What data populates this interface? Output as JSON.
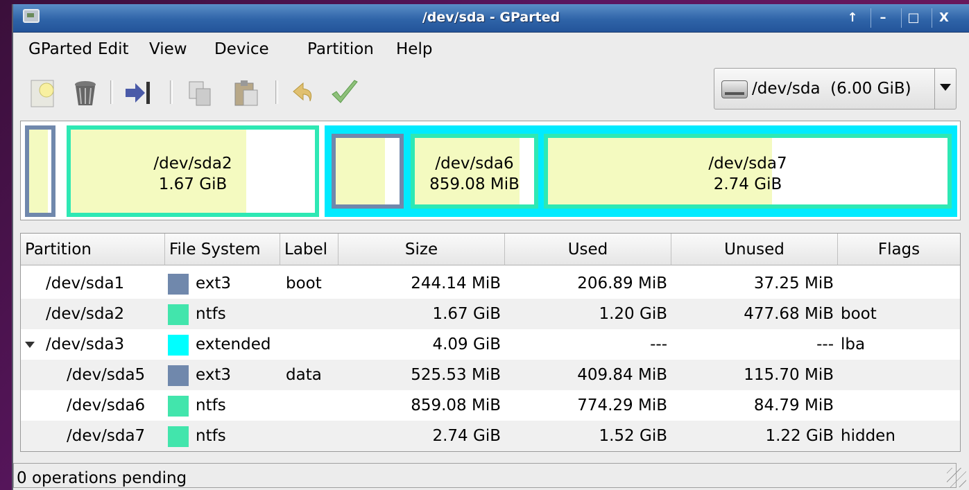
{
  "window": {
    "title": "/dev/sda - GParted"
  },
  "titlebar_buttons": {
    "up": "↑",
    "minimize": "–",
    "maximize": "□",
    "close": "X"
  },
  "menu": [
    "GParted",
    "Edit",
    "View",
    "Device",
    "Partition",
    "Help"
  ],
  "toolbar": {
    "tools": [
      "new-icon",
      "delete-icon",
      "resize-move-icon",
      "copy-icon",
      "paste-icon",
      "undo-icon",
      "apply-icon"
    ]
  },
  "device": {
    "name": "/dev/sda",
    "size": "(6.00 GiB)"
  },
  "partition_map": [
    {
      "name": "",
      "size": ""
    },
    {
      "name": "/dev/sda2",
      "size": "1.67 GiB"
    },
    {
      "name": "",
      "size": ""
    },
    {
      "name": "/dev/sda6",
      "size": "859.08 MiB"
    },
    {
      "name": "/dev/sda7",
      "size": "2.74 GiB"
    }
  ],
  "table": {
    "headers": [
      "Partition",
      "File System",
      "Label",
      "Size",
      "Used",
      "Unused",
      "Flags"
    ],
    "rows": [
      {
        "partition": "/dev/sda1",
        "fs": "ext3",
        "label": "boot",
        "size": "244.14 MiB",
        "used": "206.89 MiB",
        "unused": "37.25 MiB",
        "flags": ""
      },
      {
        "partition": "/dev/sda2",
        "fs": "ntfs",
        "label": "",
        "size": "1.67 GiB",
        "used": "1.20 GiB",
        "unused": "477.68 MiB",
        "flags": "boot"
      },
      {
        "partition": "/dev/sda3",
        "fs": "extended",
        "label": "",
        "size": "4.09 GiB",
        "used": "---",
        "unused": "---",
        "flags": "lba"
      },
      {
        "partition": "/dev/sda5",
        "fs": "ext3",
        "label": "data",
        "size": "525.53 MiB",
        "used": "409.84 MiB",
        "unused": "115.70 MiB",
        "flags": ""
      },
      {
        "partition": "/dev/sda6",
        "fs": "ntfs",
        "label": "",
        "size": "859.08 MiB",
        "used": "774.29 MiB",
        "unused": "84.79 MiB",
        "flags": ""
      },
      {
        "partition": "/dev/sda7",
        "fs": "ntfs",
        "label": "",
        "size": "2.74 GiB",
        "used": "1.52 GiB",
        "unused": "1.22 GiB",
        "flags": "hidden"
      }
    ]
  },
  "colors": {
    "ext3": "#7088ac",
    "ntfs": "#42e5ac",
    "extended": "#00ffff",
    "used_fill": "#f4fac0"
  },
  "status": {
    "text": "0 operations pending"
  }
}
